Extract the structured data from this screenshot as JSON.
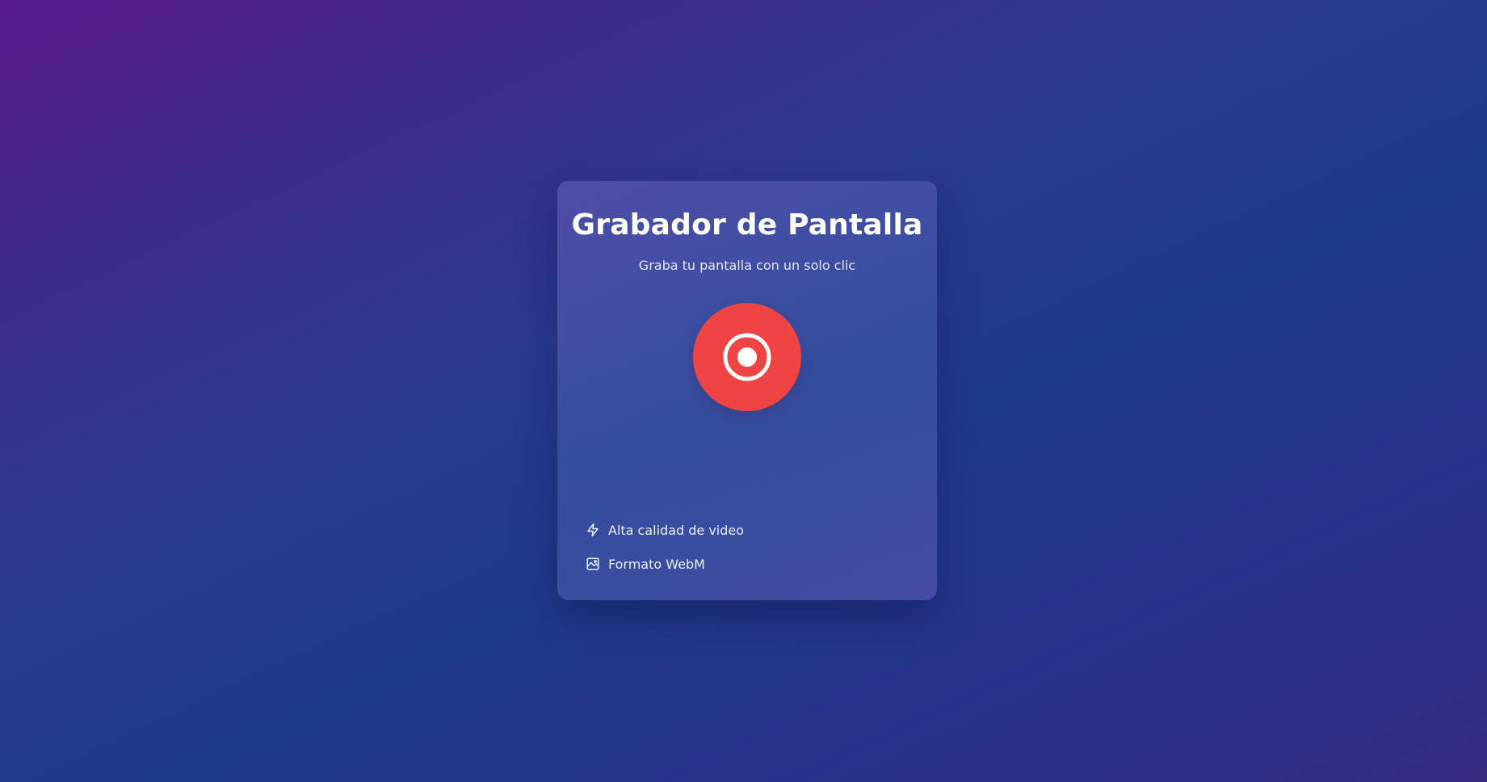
{
  "card": {
    "title": "Grabador de Pantalla",
    "subtitle": "Graba tu pantalla con un solo clic"
  },
  "record_button": {
    "icon": "record-icon",
    "color": "#ef4444"
  },
  "features": [
    {
      "icon": "lightning-icon",
      "label": "Alta calidad de video"
    },
    {
      "icon": "image-icon",
      "label": "Formato WebM"
    }
  ]
}
